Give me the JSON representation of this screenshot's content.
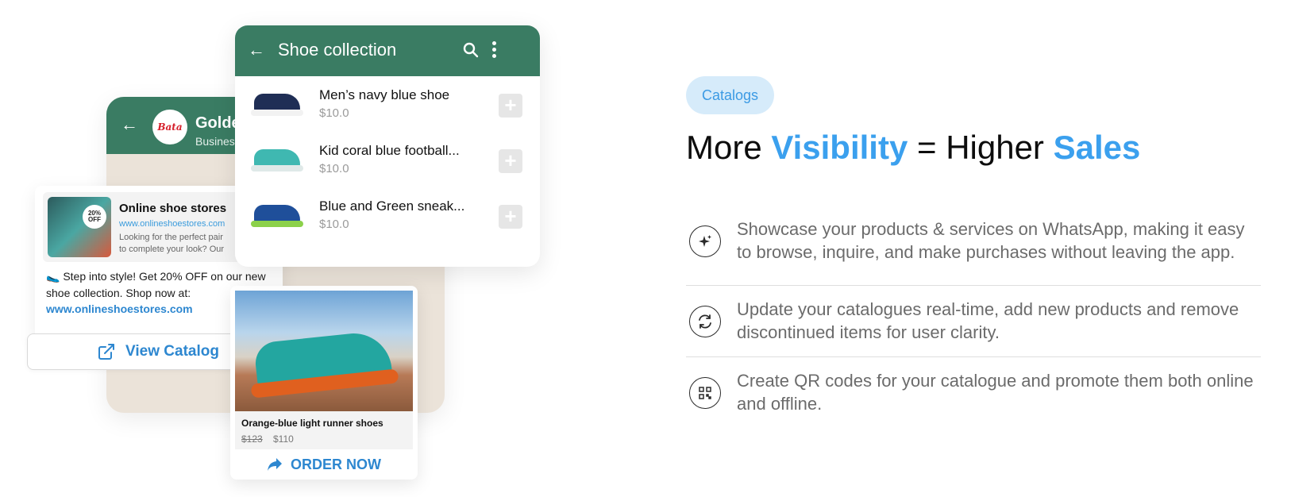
{
  "chat": {
    "business_name": "Golde",
    "business_subtitle": "Busines",
    "avatar_text": "Bata",
    "preview": {
      "title": "Online shoe stores",
      "url": "www.onlineshoestores.com",
      "description_line1": "Looking for the perfect pair",
      "description_line2": "to complete your look? Our",
      "badge": "20% OFF"
    },
    "message": "🥿 Step into style! Get 20% OFF on our new shoe collection. Shop now at:",
    "message_link": "www.onlineshoestores.com",
    "view_catalog_label": "View Catalog"
  },
  "collection": {
    "title": "Shoe collection",
    "items": [
      {
        "name": "Men’s navy blue shoe",
        "price": "$10.0",
        "upper_color": "#1f2e55",
        "sole_color": "#f2f2f2"
      },
      {
        "name": "Kid coral blue football...",
        "price": "$10.0",
        "upper_color": "#3fb8b1",
        "sole_color": "#dfe9e8"
      },
      {
        "name": "Blue and Green sneak...",
        "price": "$10.0",
        "upper_color": "#1f4f9a",
        "sole_color": "#8cd14a"
      }
    ],
    "add_symbol": "+"
  },
  "product": {
    "name": "Orange-blue light runner shoes",
    "price_old": "$123",
    "price_new": "$110",
    "order_label": "ORDER NOW"
  },
  "feature_section": {
    "badge": "Catalogs",
    "headline_part1": "More ",
    "headline_accent1": "Visibility",
    "headline_part2": " = Higher ",
    "headline_accent2": "Sales",
    "features": [
      {
        "icon": "sparkle-icon",
        "text": "Showcase your products & services on WhatsApp, making it easy to browse, inquire, and make purchases without leaving the app."
      },
      {
        "icon": "refresh-icon",
        "text": "Update your catalogues real-time, add new products and remove discontinued items for user clarity."
      },
      {
        "icon": "qr-code-icon",
        "text": "Create QR codes for your catalogue and promote them both online and offline."
      }
    ]
  },
  "colors": {
    "whatsapp_green": "#3a7c63",
    "accent_blue": "#3ba0ee",
    "link_blue": "#2d87d0",
    "badge_bg": "#d6ebfa"
  }
}
